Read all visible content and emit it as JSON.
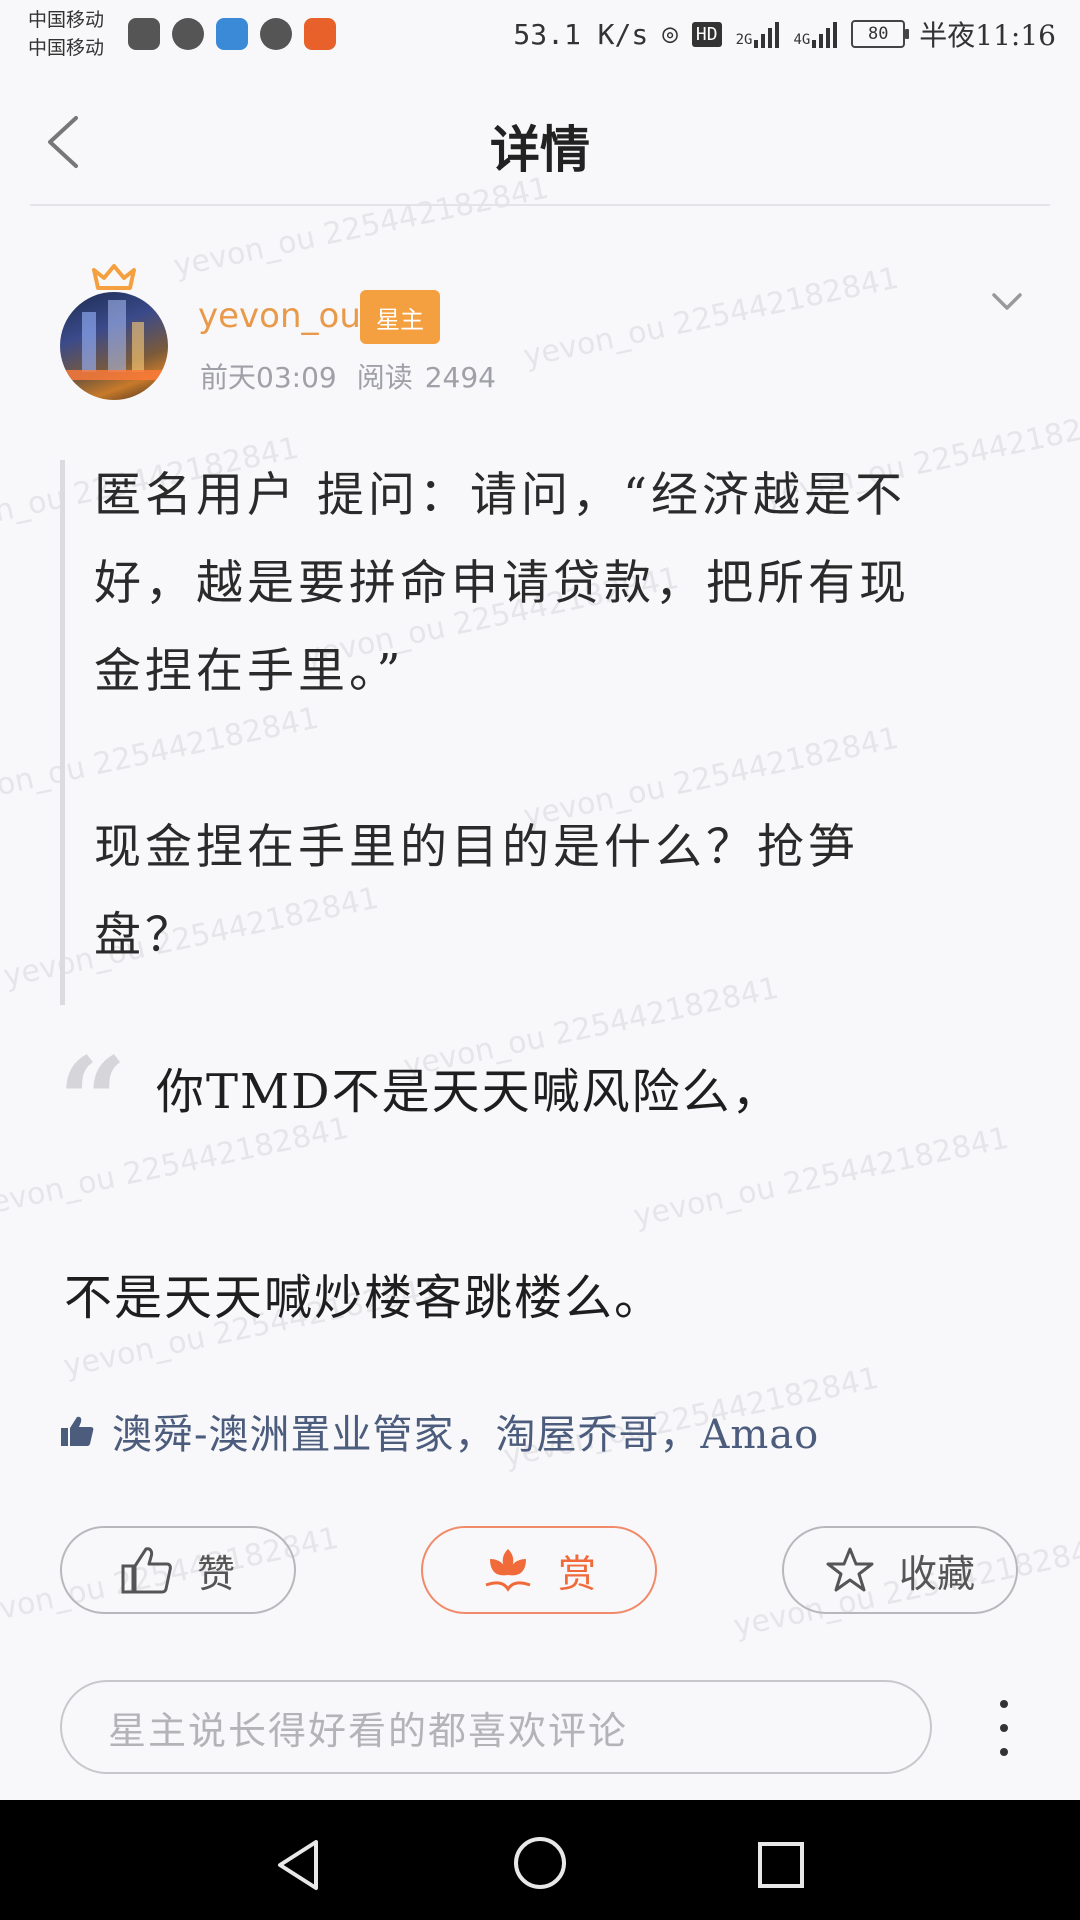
{
  "status_bar": {
    "carrier1": "中国移动",
    "carrier2": "中国移动",
    "speed": "53.1 K/s",
    "net_hd": "HD",
    "sig1": "2G",
    "sig2": "4G",
    "battery": "80",
    "time": "半夜11:16"
  },
  "header": {
    "title": "详情"
  },
  "author": {
    "name": "yevon_ou",
    "badge": "星主",
    "date": "前天03:09",
    "reads_label": "阅读",
    "reads": "2494"
  },
  "quote": {
    "lines": [
      "匿名用户  提问：请问，“经济越是不",
      "好，越是要拼命申请贷款，把所有现",
      "金捏在手里。”",
      "现金捏在手里的目的是什么？抢笋",
      "盘？"
    ]
  },
  "body": {
    "quote_mark": "“",
    "line1": "你TMD不是天天喊风险么，",
    "line2": "不是天天喊炒楼客跳楼么。"
  },
  "likes": {
    "text": "澳舜-澳洲置业管家，淘屋乔哥，Amao"
  },
  "actions": {
    "like": "赞",
    "reward": "赏",
    "collect": "收藏"
  },
  "comment": {
    "placeholder": "星主说长得好看的都喜欢评论"
  },
  "watermark": {
    "text": "yevon_ou 225442182841"
  },
  "colors": {
    "accent": "#f5a040",
    "username": "#e89a4a",
    "reward": "#f06a3a",
    "likes": "#4c5c7c"
  }
}
